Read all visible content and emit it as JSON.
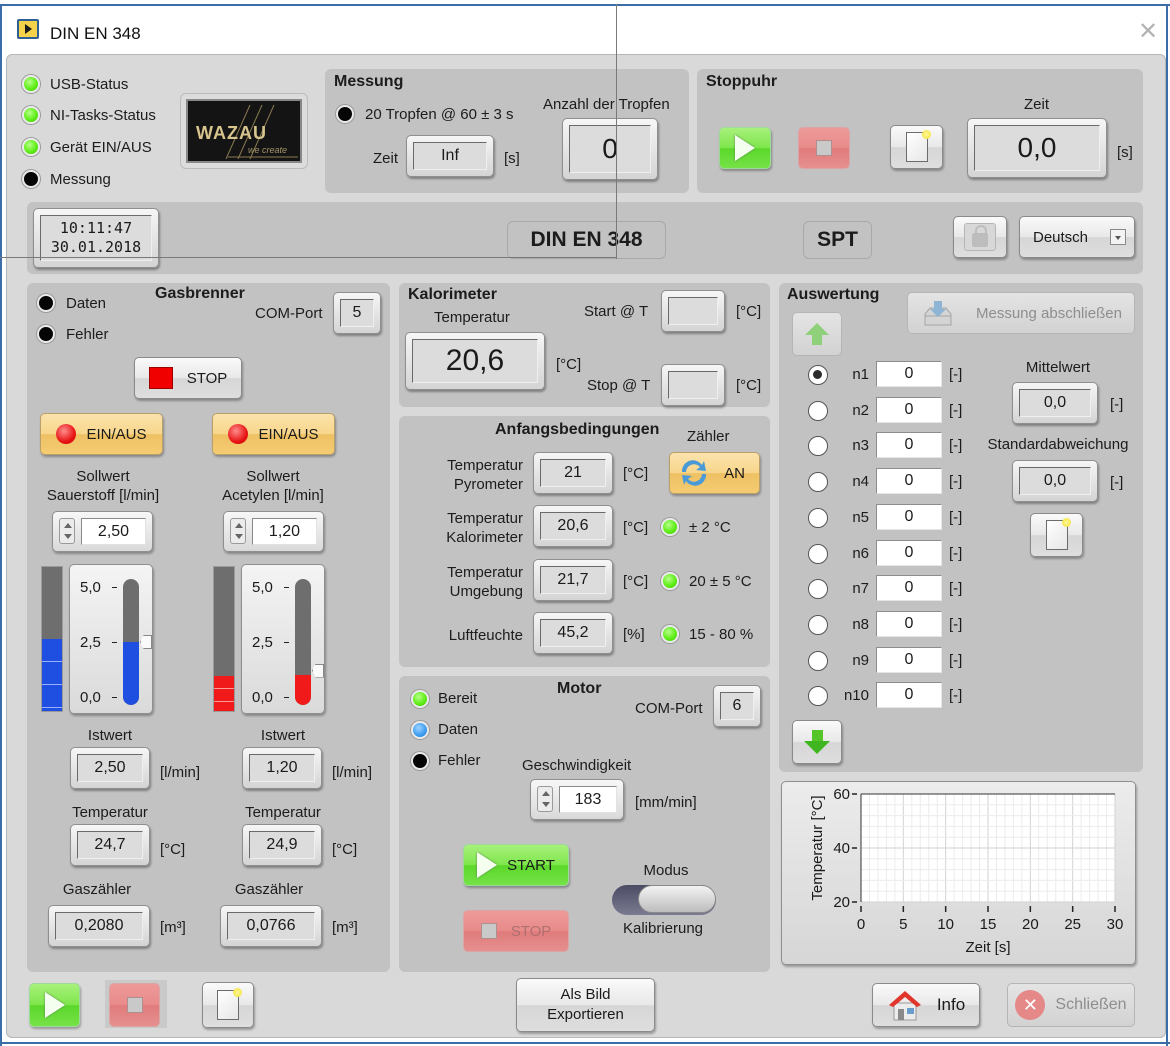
{
  "window": {
    "title": "DIN EN 348",
    "close_icon": "close-icon"
  },
  "status_leds": [
    {
      "label": "USB-Status",
      "state": "green"
    },
    {
      "label": "NI-Tasks-Status",
      "state": "green"
    },
    {
      "label": "Gerät EIN/AUS",
      "state": "green"
    },
    {
      "label": "Messung",
      "state": "black"
    }
  ],
  "logo": {
    "brand": "WAZAU",
    "tagline": "we create"
  },
  "messung": {
    "title": "Messung",
    "option_label": "20 Tropfen @ 60 ± 3 s",
    "zeit_label": "Zeit",
    "zeit_value": "Inf",
    "zeit_unit": "[s]",
    "count_label": "Anzahl der Tropfen",
    "count_value": "0"
  },
  "stoppuhr": {
    "title": "Stoppuhr",
    "zeit_label": "Zeit",
    "zeit_value": "0,0",
    "zeit_unit": "[s]"
  },
  "header_bar": {
    "time": "10:11:47",
    "date": "30.01.2018",
    "standard_label": "DIN EN 348",
    "spt_label": "SPT",
    "language": "Deutsch"
  },
  "gasbrenner": {
    "title": "Gasbrenner",
    "daten_label": "Daten",
    "fehler_label": "Fehler",
    "com_label": "COM-Port",
    "com_value": "5",
    "stop_label": "STOP",
    "channels": [
      {
        "toggle_label": "EIN/AUS",
        "sollwert_label_1": "Sollwert",
        "sollwert_label_2": "Sauerstoff [l/min]",
        "sollwert_value": "2,50",
        "gauge_ticks": [
          "5,0",
          "2,5",
          "0,0"
        ],
        "gauge_max": 5.0,
        "bar_level": 2.5,
        "tube_level": 2.5,
        "color": "#1f4fe0",
        "istwert_label": "Istwert",
        "istwert_value": "2,50",
        "istwert_unit": "[l/min]",
        "temp_label": "Temperatur",
        "temp_value": "24,7",
        "temp_unit": "[°C]",
        "gas_label": "Gaszähler",
        "gas_value": "0,2080",
        "gas_unit": "[m³]"
      },
      {
        "toggle_label": "EIN/AUS",
        "sollwert_label_1": "Sollwert",
        "sollwert_label_2": "Acetylen [l/min]",
        "sollwert_value": "1,20",
        "gauge_ticks": [
          "5,0",
          "2,5",
          "0,0"
        ],
        "gauge_max": 5.0,
        "bar_level": 1.2,
        "tube_level": 1.2,
        "color": "#f01a1a",
        "istwert_label": "Istwert",
        "istwert_value": "1,20",
        "istwert_unit": "[l/min]",
        "temp_label": "Temperatur",
        "temp_value": "24,9",
        "temp_unit": "[°C]",
        "gas_label": "Gaszähler",
        "gas_value": "0,0766",
        "gas_unit": "[m³]"
      }
    ]
  },
  "kalorimeter": {
    "title": "Kalorimeter",
    "temp_label": "Temperatur",
    "temp_value": "20,6",
    "temp_unit": "[°C]",
    "start_label": "Start @ T",
    "start_value": "",
    "start_unit": "[°C]",
    "stop_label": "Stop @ T",
    "stop_value": "",
    "stop_unit": "[°C]"
  },
  "anfangsbedingungen": {
    "title": "Anfangsbedingungen",
    "zaehler_label": "Zähler",
    "zaehler_button": "AN",
    "rows": [
      {
        "label_1": "Temperatur",
        "label_2": "Pyrometer",
        "value": "21",
        "unit": "[°C]",
        "led": null,
        "range": ""
      },
      {
        "label_1": "Temperatur",
        "label_2": "Kalorimeter",
        "value": "20,6",
        "unit": "[°C]",
        "led": "green",
        "range": "± 2 °C"
      },
      {
        "label_1": "Temperatur",
        "label_2": "Umgebung",
        "value": "21,7",
        "unit": "[°C]",
        "led": "green",
        "range": "20 ± 5 °C"
      },
      {
        "label_1": "Luftfeuchte",
        "label_2": "",
        "value": "45,2",
        "unit": "[%]",
        "led": "green",
        "range": "15 - 80 %"
      }
    ]
  },
  "motor": {
    "title": "Motor",
    "bereit_label": "Bereit",
    "daten_label": "Daten",
    "fehler_label": "Fehler",
    "com_label": "COM-Port",
    "com_value": "6",
    "speed_label": "Geschwindigkeit",
    "speed_value": "183",
    "speed_unit": "[mm/min]",
    "start_label": "START",
    "stop_label": "STOP",
    "modus_label": "Modus",
    "modus_value": "Kalibrierung"
  },
  "auswertung": {
    "title": "Auswertung",
    "finish_button": "Messung abschließen",
    "selected_index": 0,
    "rows": [
      {
        "label": "n1",
        "value": "0",
        "unit": "[-]"
      },
      {
        "label": "n2",
        "value": "0",
        "unit": "[-]"
      },
      {
        "label": "n3",
        "value": "0",
        "unit": "[-]"
      },
      {
        "label": "n4",
        "value": "0",
        "unit": "[-]"
      },
      {
        "label": "n5",
        "value": "0",
        "unit": "[-]"
      },
      {
        "label": "n6",
        "value": "0",
        "unit": "[-]"
      },
      {
        "label": "n7",
        "value": "0",
        "unit": "[-]"
      },
      {
        "label": "n8",
        "value": "0",
        "unit": "[-]"
      },
      {
        "label": "n9",
        "value": "0",
        "unit": "[-]"
      },
      {
        "label": "n10",
        "value": "0",
        "unit": "[-]"
      }
    ],
    "mittelwert_label": "Mittelwert",
    "mittelwert_value": "0,0",
    "mittelwert_unit": "[-]",
    "std_label": "Standardabweichung",
    "std_value": "0,0",
    "std_unit": "[-]"
  },
  "chart_data": {
    "type": "line",
    "title": "",
    "xlabel": "Zeit [s]",
    "ylabel": "Temperatur [°C]",
    "xlim": [
      0,
      30
    ],
    "ylim": [
      20,
      60
    ],
    "x_ticks": [
      "0",
      "5",
      "10",
      "15",
      "20",
      "25",
      "30"
    ],
    "y_ticks": [
      "60",
      "40",
      "20"
    ],
    "grid": true,
    "series": []
  },
  "footer": {
    "export_label_1": "Als Bild",
    "export_label_2": "Exportieren",
    "info_label": "Info",
    "close_label": "Schließen"
  }
}
